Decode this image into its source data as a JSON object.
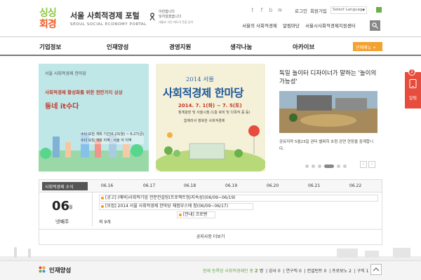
{
  "header": {
    "logo_top": "싱싱",
    "logo_bottom": "회경",
    "site_name": "서울 사회적경제 포털",
    "site_subtitle": "SEOUL SOCIAL ECONOMY PORTAL",
    "slogan_line1": "이만합니다",
    "slogan_line2": "잊지않겠습니다",
    "slogan_line3": "세월호 국민 애도의 뜻을 담아",
    "sns_icons": [
      "twitter-icon",
      "facebook-icon",
      "blog-icon",
      "rss-icon"
    ],
    "login": "로그인",
    "signup": "회원가입",
    "language": "Select Language",
    "utility_links": [
      "서울의 사회적경제",
      "알림마당",
      "서울시사회적경제지원센터"
    ]
  },
  "gnb": {
    "items": [
      "기업정보",
      "인재양성",
      "경영지원",
      "생각나눔",
      "아카이브"
    ],
    "all_menu": "전체메뉴 +"
  },
  "banner1": {
    "small": "서울 사회적경제 한마당",
    "headline": "사회적경제 활성화를 위한 천만가지 상상",
    "title": "동네 it수다",
    "note_line1": "수다 모임 개최 기간(6.23(월) ~ 6.27(금)",
    "note_line2": "수다 모임 개최 지역 : 서울 각 지역"
  },
  "banner2": {
    "year": "2014 서울",
    "title": "사회적경제 한마당",
    "date": "2014. 7. 1(화) ~ 7. 5(토)",
    "place": "청계광장 및 서울시청 (1층 로비 및 다목적 홀 등)",
    "slogan": "함께라서 행복한 사회적경제"
  },
  "banner3": {
    "title": "독일 놀이터 디자이너가 말하는 '놀이의 가능성'",
    "desc": "공유저작 5월23일 귄터 벨찌히 초청 강연 현장을 중계합니다."
  },
  "schedule": {
    "tag": "사회적경제 소식",
    "dates": [
      "06.16",
      "06.17",
      "06.18",
      "06.19",
      "06.20",
      "06.21",
      "06.22"
    ],
    "day": "06",
    "day_suffix": "월",
    "week": "넷째주",
    "events": [
      "[공고] (예비)사회적기업 전문컨설팅(프로젝트형/지속성)(06/09~06/19)",
      "[모집] 2014 서울 사회적경제 한마당 체험부스에 참(06/09~06/17)",
      "[안내] 코로벤",
      "외 9개"
    ],
    "more": "공지사항 더보기"
  },
  "bottom": {
    "title": "인재양성",
    "stats_prefix": "현재 등록된 사회적경제인 총",
    "stats_total": "2",
    "stats_unit": "명",
    "stats_items": [
      "강사 0",
      "연구직 0",
      "컨설턴트 0",
      "프로보노 2",
      "구직 1"
    ]
  },
  "side_tab": {
    "badge": "2",
    "label": "알림"
  },
  "colors": {
    "accent": "#f3a12f",
    "alert": "#e74c3c",
    "banner1_bg": "#bfe7e8",
    "banner2_bg": "#f5f1d8",
    "title_blue": "#1e5799",
    "green": "#6aa84f"
  }
}
